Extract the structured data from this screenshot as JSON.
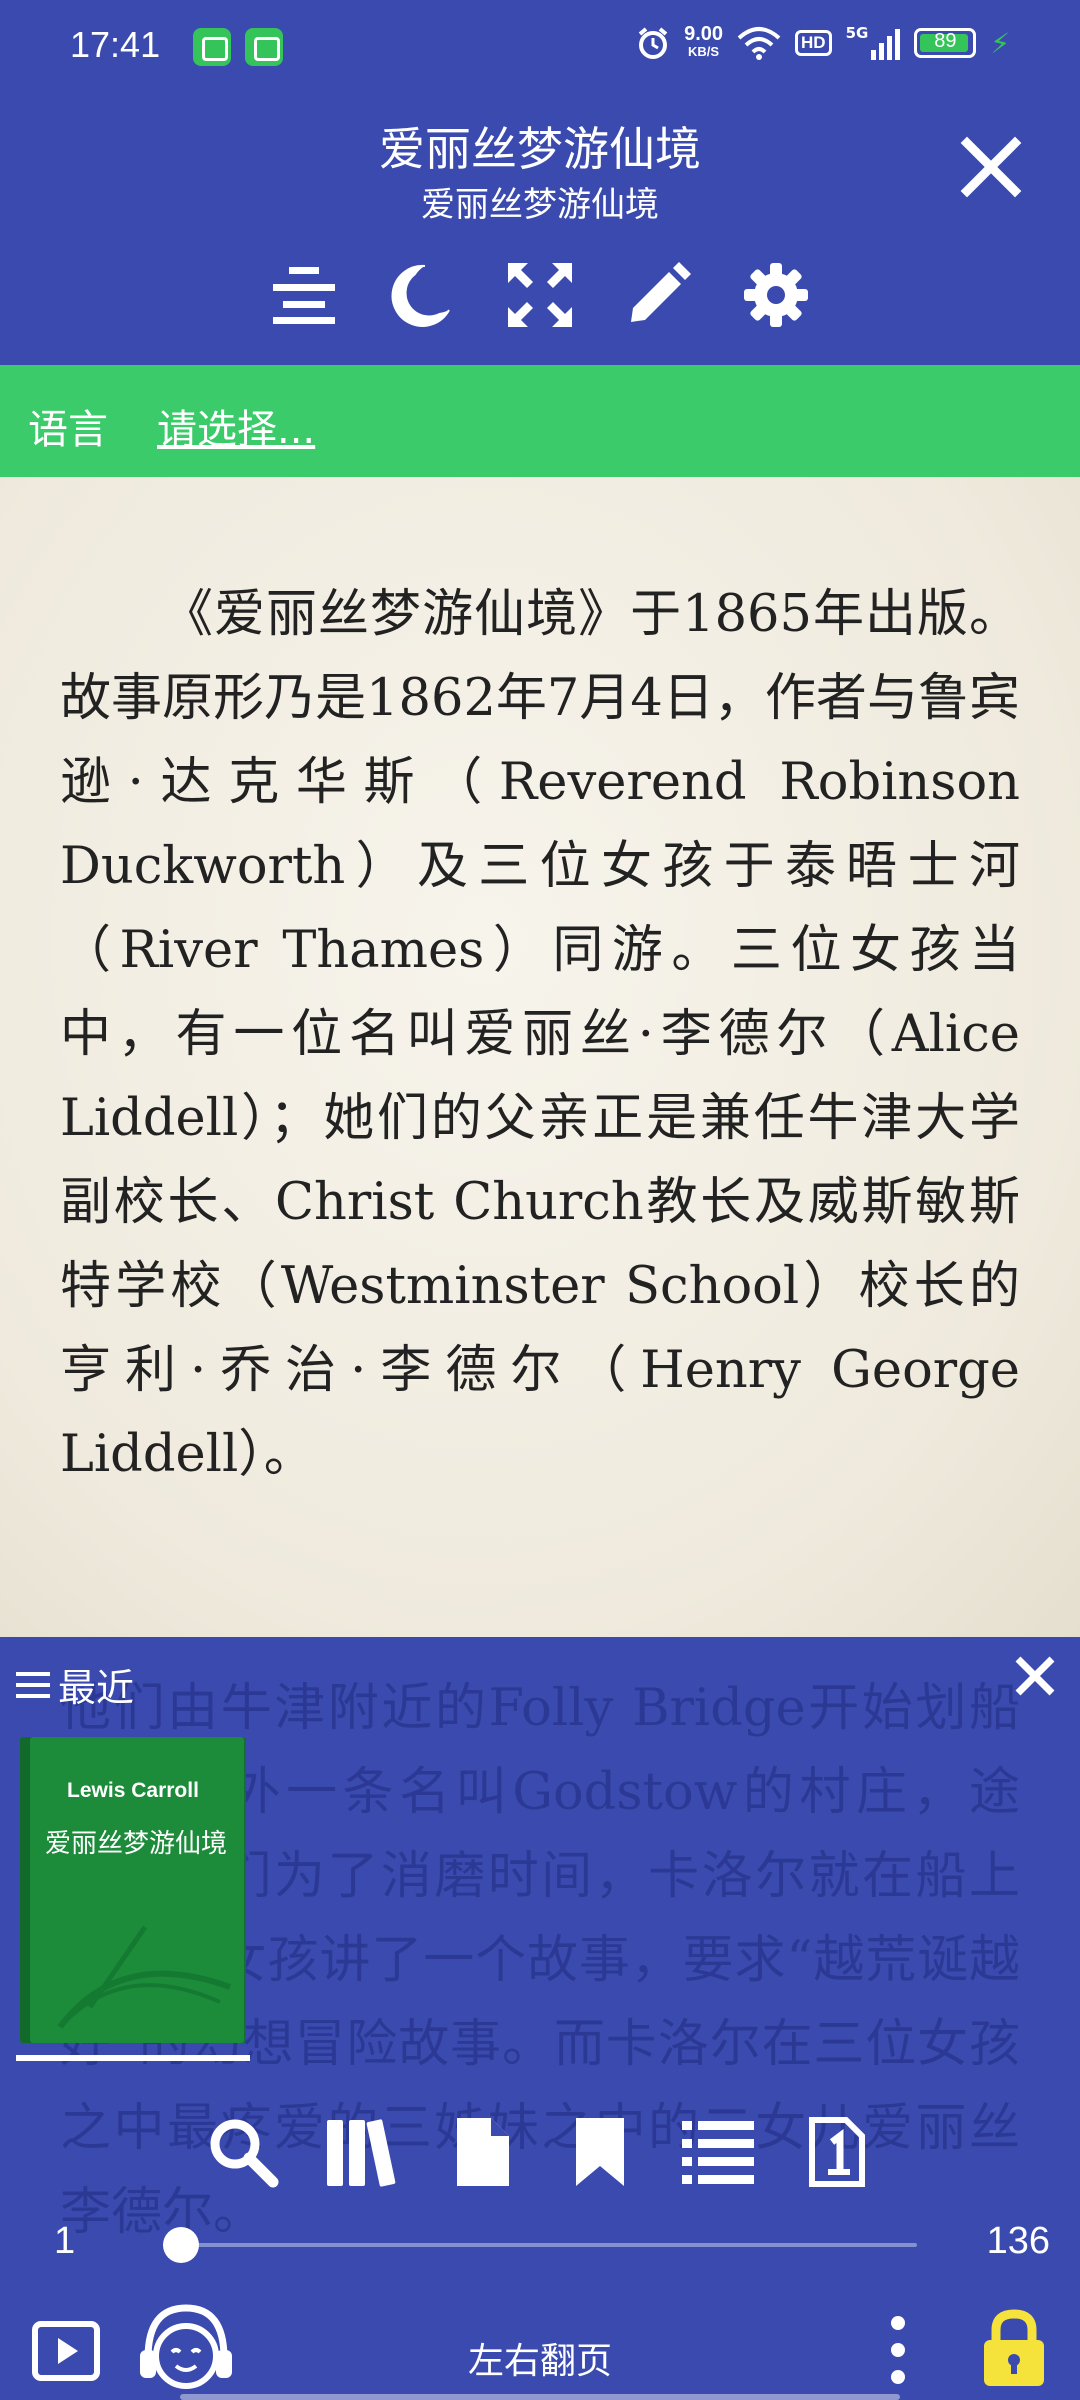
{
  "status_bar": {
    "time": "17:41",
    "net_speed_value": "9.00",
    "net_speed_unit": "KB/S",
    "hd_label": "HD",
    "signal_label": "5G",
    "battery_level": "89",
    "battery_fraction": 0.89
  },
  "header": {
    "title": "爱丽丝梦游仙境",
    "subtitle": "爱丽丝梦游仙境"
  },
  "toolbar_icons": [
    "align-center-icon",
    "moon-icon",
    "fullscreen-icon",
    "pencil-icon",
    "gear-icon"
  ],
  "language_bar": {
    "label": "语言",
    "select_placeholder": "请选择..."
  },
  "reader": {
    "paragraph": "《爱丽丝梦游仙境》于1865年出版。故事原形乃是1862年7月4日，作者与鲁宾逊·达克华斯（Reverend Robinson Duckworth）及三位女孩于泰晤士河（River Thames）同游。三位女孩当中，有一位名叫爱丽丝·李德尔（Alice Liddell）；她们的父亲正是兼任牛津大学副校长、Christ Church教长及威斯敏斯特学校（Westminster School）校长的亨利·乔治·李德尔（Henry George Liddell）。",
    "continuation": "他们由牛津附近的Folly Bridge开始划船到五哩外一条名叫Godstow的村庄，途中，他们为了消磨时间，卡洛尔就在船上向三位女孩讲了一个故事，要求“越荒诞越好”的幻想冒险故事。而卡洛尔在三位女孩之中最疼爱的三姊妹之中的二女儿爱丽丝李德尔。"
  },
  "recent_panel": {
    "header": "最近",
    "books": [
      {
        "author": "Lewis Carroll",
        "title": "爱丽丝梦游仙境",
        "cover_color": "#1C8B3A"
      }
    ]
  },
  "actions": [
    "search-icon",
    "library-icon",
    "file-icon",
    "bookmark-icon",
    "list-icon",
    "page-number-icon"
  ],
  "pager": {
    "start": "1",
    "end": "136",
    "progress": 0.0
  },
  "bottom_bar": {
    "flip_mode": "左右翻页"
  },
  "colors": {
    "primary": "#3A4AAE",
    "language_bar": "#3CCB6A",
    "paper": "#F2EEE3",
    "lock": "#F5E23A"
  }
}
